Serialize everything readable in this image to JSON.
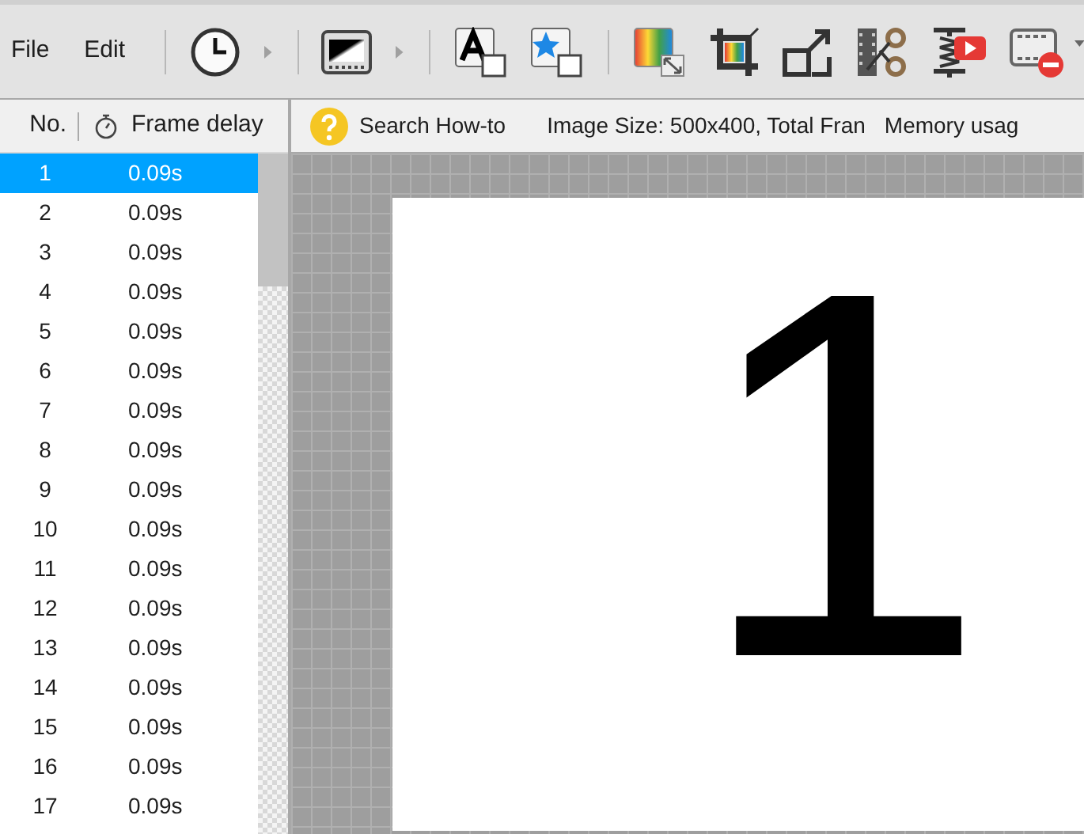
{
  "menu": [
    {
      "label": "File"
    },
    {
      "label": "Edit"
    }
  ],
  "frame_list": {
    "columns": [
      "No.",
      "Frame delay"
    ],
    "rows": [
      {
        "number": "1",
        "delay": "0.09s",
        "selected": true
      },
      {
        "number": "2",
        "delay": "0.09s",
        "selected": false
      },
      {
        "number": "3",
        "delay": "0.09s",
        "selected": false
      },
      {
        "number": "4",
        "delay": "0.09s",
        "selected": false
      },
      {
        "number": "5",
        "delay": "0.09s",
        "selected": false
      },
      {
        "number": "6",
        "delay": "0.09s",
        "selected": false
      },
      {
        "number": "7",
        "delay": "0.09s",
        "selected": false
      },
      {
        "number": "8",
        "delay": "0.09s",
        "selected": false
      },
      {
        "number": "9",
        "delay": "0.09s",
        "selected": false
      },
      {
        "number": "10",
        "delay": "0.09s",
        "selected": false
      },
      {
        "number": "11",
        "delay": "0.09s",
        "selected": false
      },
      {
        "number": "12",
        "delay": "0.09s",
        "selected": false
      },
      {
        "number": "13",
        "delay": "0.09s",
        "selected": false
      },
      {
        "number": "14",
        "delay": "0.09s",
        "selected": false
      },
      {
        "number": "15",
        "delay": "0.09s",
        "selected": false
      },
      {
        "number": "16",
        "delay": "0.09s",
        "selected": false
      },
      {
        "number": "17",
        "delay": "0.09s",
        "selected": false
      }
    ]
  },
  "info_bar": {
    "help": "Search How-to",
    "image_info": "Image Size: 500x400, Total Fran",
    "memory": "Memory usag"
  },
  "canvas": {
    "frame_text": "1"
  }
}
